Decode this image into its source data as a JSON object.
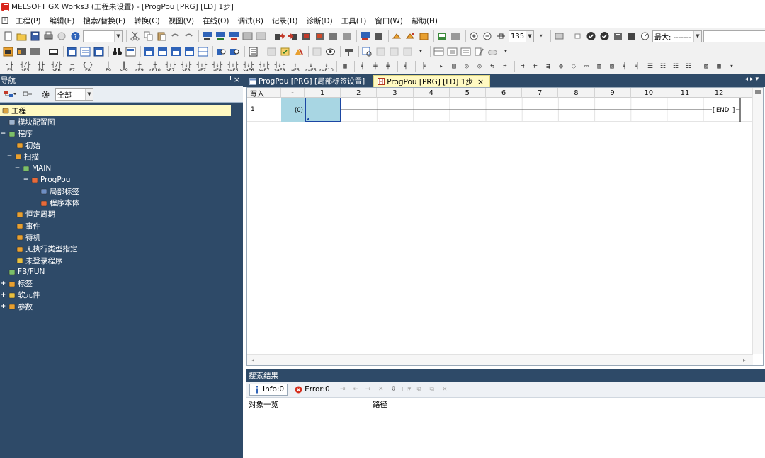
{
  "window": {
    "title": "MELSOFT GX Works3 (工程未设置) - [ProgPou [PRG] [LD] 1步]"
  },
  "menu": {
    "items": [
      "工程(P)",
      "编辑(E)",
      "搜索/替换(F)",
      "转换(C)",
      "视图(V)",
      "在线(O)",
      "调试(B)",
      "记录(R)",
      "诊断(D)",
      "工具(T)",
      "窗口(W)",
      "帮助(H)"
    ]
  },
  "toolbar": {
    "zoom_value": "135",
    "max_label": "最大: -------",
    "fkeys": [
      {
        "glyph": "┤├",
        "label": "F5"
      },
      {
        "glyph": "┤/├",
        "label": "sF5"
      },
      {
        "glyph": "┤├",
        "label": "F6"
      },
      {
        "glyph": "┤/├",
        "label": "sF6"
      },
      {
        "glyph": "─",
        "label": "F7"
      },
      {
        "glyph": "{ }",
        "label": "F8"
      },
      {
        "glyph": "│",
        "label": "F9"
      },
      {
        "glyph": "┃",
        "label": "sF9"
      },
      {
        "glyph": "┼",
        "label": "cF9"
      },
      {
        "glyph": "┼",
        "label": "cF10"
      },
      {
        "glyph": "┤↑├",
        "label": "sF7"
      },
      {
        "glyph": "┤↓├",
        "label": "sF8"
      },
      {
        "glyph": "┤↑├",
        "label": "aF7"
      },
      {
        "glyph": "┤↓├",
        "label": "aF8"
      },
      {
        "glyph": "┤↑├",
        "label": "saF5"
      },
      {
        "glyph": "┤↓├",
        "label": "saF6"
      },
      {
        "glyph": "┤↑├",
        "label": "saF7"
      },
      {
        "glyph": "┤↓├",
        "label": "saF8"
      },
      {
        "glyph": "↑",
        "label": "aF5"
      },
      {
        "glyph": "↓",
        "label": "caF5"
      },
      {
        "glyph": "↕",
        "label": "caF10"
      }
    ]
  },
  "navigation": {
    "title": "导航",
    "filter": "全部",
    "tree": [
      {
        "label": "工程",
        "level": 0,
        "expander": "",
        "icon": "project-icon",
        "selected": true
      },
      {
        "label": "模块配置图",
        "level": 1,
        "expander": "",
        "icon": "module-config-icon"
      },
      {
        "label": "程序",
        "level": 0,
        "expander": "−",
        "icon": "program-icon"
      },
      {
        "label": "初始",
        "level": 2,
        "expander": "",
        "icon": "task-icon"
      },
      {
        "label": "扫描",
        "level": 1,
        "expander": "−",
        "icon": "task-icon"
      },
      {
        "label": "MAIN",
        "level": 2,
        "expander": "−",
        "icon": "program-block-icon"
      },
      {
        "label": "ProgPou",
        "level": 3,
        "expander": "−",
        "icon": "pou-icon"
      },
      {
        "label": "局部标签",
        "level": 4,
        "expander": "",
        "icon": "local-label-icon"
      },
      {
        "label": "程序本体",
        "level": 4,
        "expander": "",
        "icon": "program-body-icon"
      },
      {
        "label": "恒定周期",
        "level": 2,
        "expander": "",
        "icon": "task-icon"
      },
      {
        "label": "事件",
        "level": 2,
        "expander": "",
        "icon": "task-icon"
      },
      {
        "label": "待机",
        "level": 2,
        "expander": "",
        "icon": "task-icon"
      },
      {
        "label": "无执行类型指定",
        "level": 2,
        "expander": "",
        "icon": "task-icon"
      },
      {
        "label": "未登录程序",
        "level": 2,
        "expander": "",
        "icon": "folder-icon"
      },
      {
        "label": "FB/FUN",
        "level": 1,
        "expander": "",
        "icon": "fb-fun-icon"
      },
      {
        "label": "标签",
        "level": 0,
        "expander": "+",
        "icon": "label-icon"
      },
      {
        "label": "软元件",
        "level": 0,
        "expander": "+",
        "icon": "device-icon"
      },
      {
        "label": "参数",
        "level": 0,
        "expander": "+",
        "icon": "parameter-icon"
      }
    ]
  },
  "editor": {
    "tabs": [
      {
        "label": "ProgPou [PRG] [局部标签设置]",
        "active": false,
        "icon": "label-table-icon"
      },
      {
        "label": "ProgPou [PRG] [LD] 1步",
        "active": true,
        "icon": "ladder-icon"
      }
    ],
    "mode_label": "写入",
    "header_dash": "-",
    "columns": [
      "1",
      "2",
      "3",
      "4",
      "5",
      "6",
      "7",
      "8",
      "9",
      "10",
      "11",
      "12"
    ],
    "row_number": "1",
    "step_label": "(0)",
    "end_label": "END"
  },
  "search_results": {
    "title": "搜索结果",
    "info_label": "Info:0",
    "error_label": "Error:0",
    "columns": [
      "对象一览",
      "路径"
    ]
  },
  "colors": {
    "nav_background": "#2e4a68",
    "selection_yellow": "#fff9c2",
    "ladder_cursor": "#a8d6e3",
    "title_logo_red": "#d9261c"
  }
}
